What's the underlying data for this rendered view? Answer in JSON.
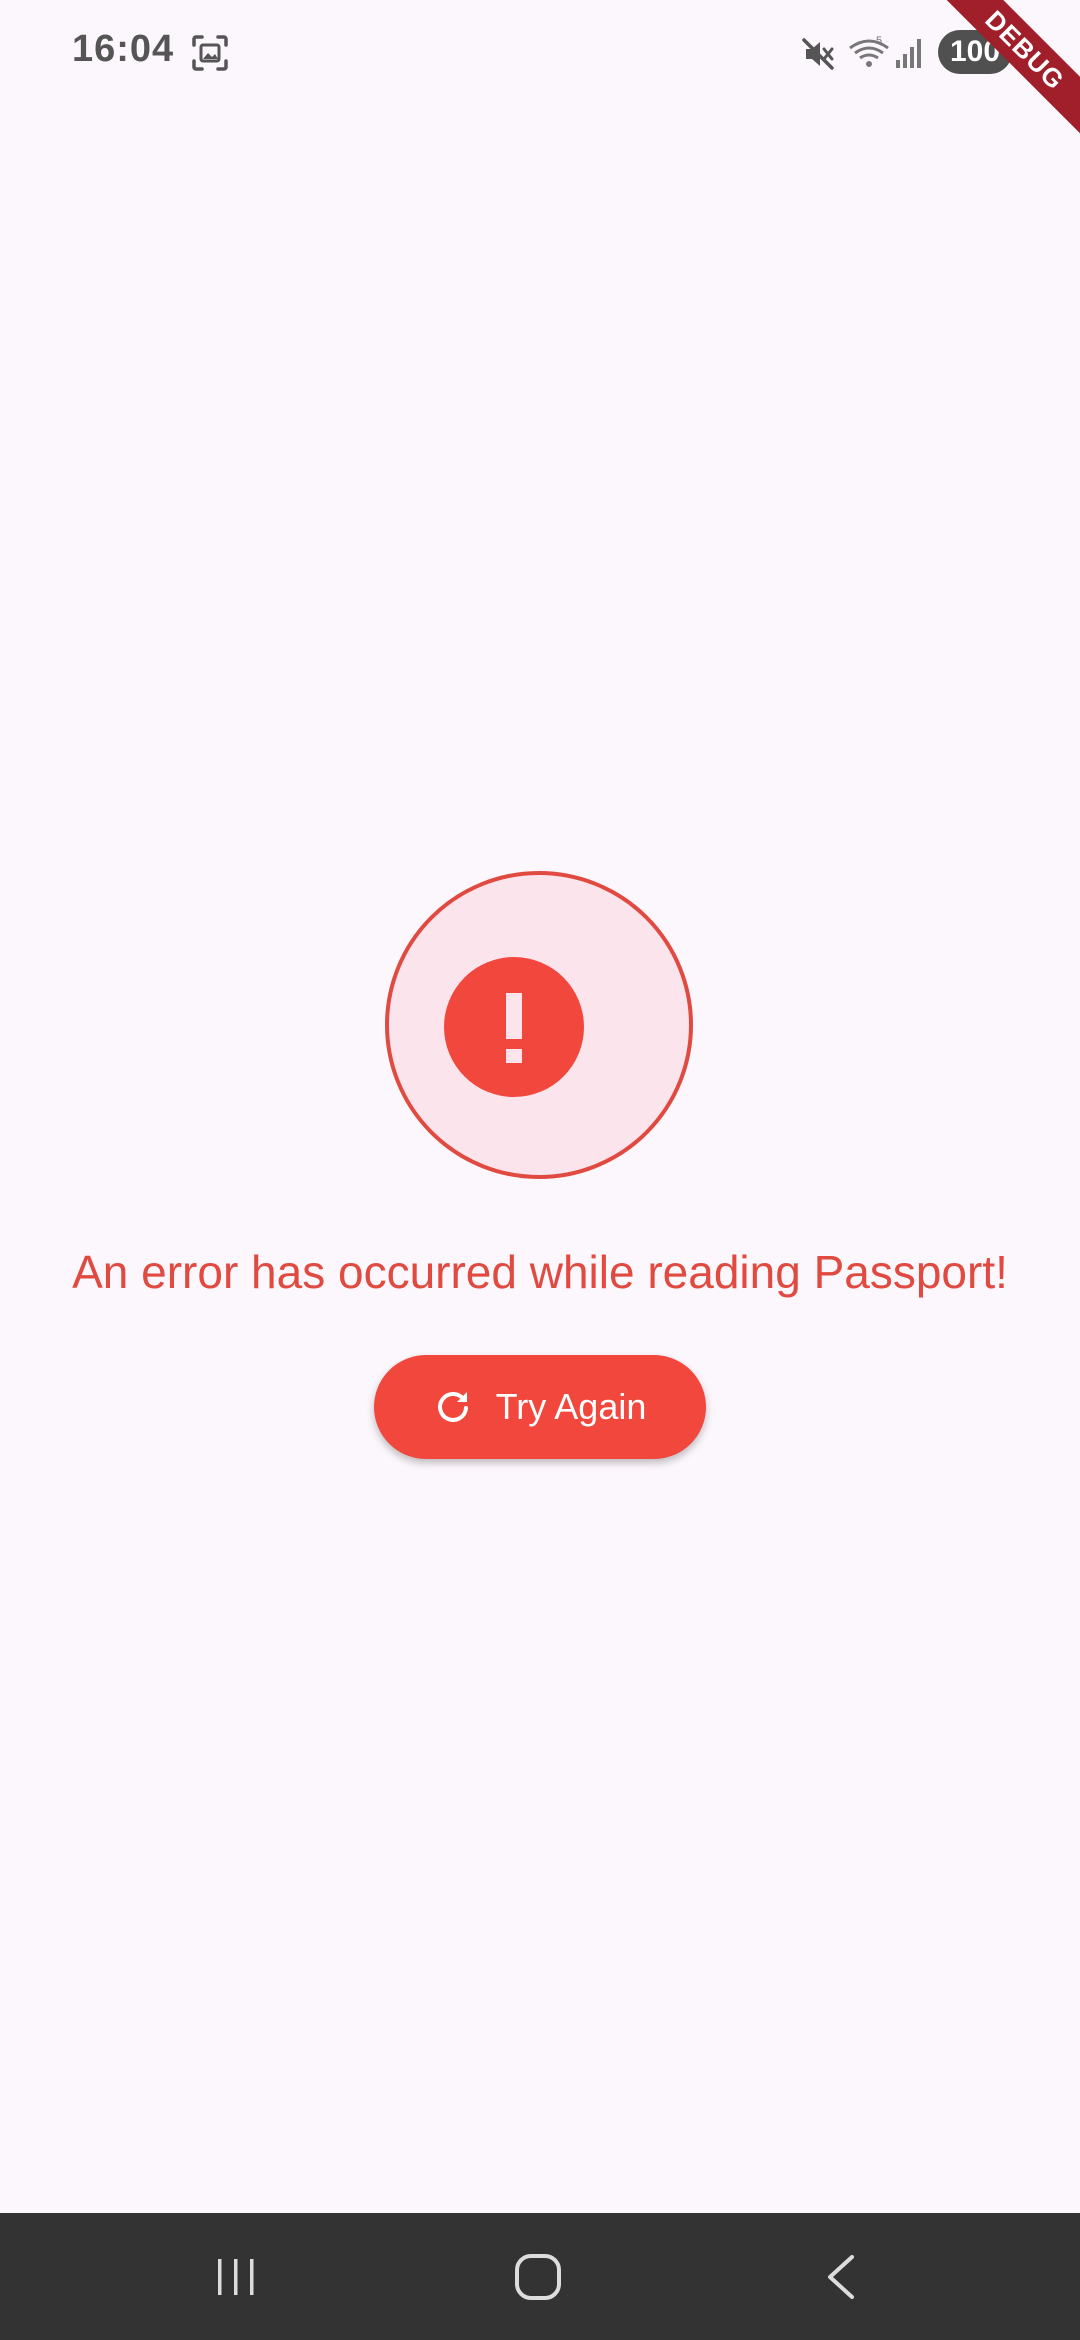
{
  "status_bar": {
    "time": "16:04",
    "battery": "100",
    "icons": [
      "screenshot-icon",
      "mute-icon",
      "wifi-icon",
      "signal-icon"
    ]
  },
  "debug_banner": {
    "label": "DEBUG"
  },
  "error": {
    "icon": "exclamation-icon",
    "message": "An error has occurred while reading Passport!"
  },
  "actions": {
    "try_again_label": "Try Again",
    "try_again_icon": "refresh-icon"
  },
  "nav_bar": {
    "buttons": [
      "recents-icon",
      "home-icon",
      "back-icon"
    ]
  },
  "colors": {
    "accent": "#f2473d",
    "error_text": "#e04a40",
    "background": "#fcf7fc",
    "circle_fill": "#fce4ec",
    "nav_bar": "#333333"
  }
}
